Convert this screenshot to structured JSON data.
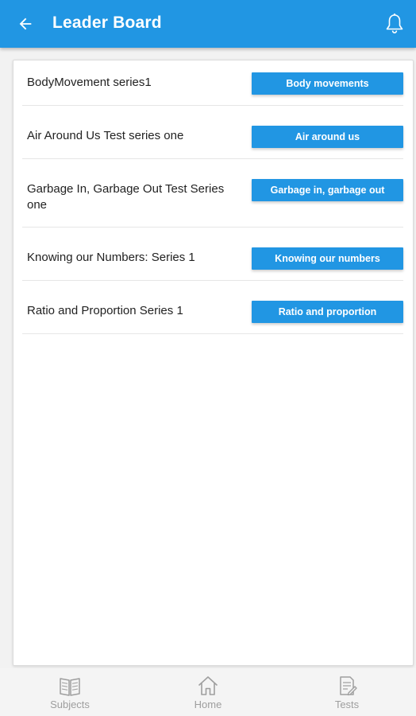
{
  "app_bar": {
    "title": "Leader Board",
    "back_icon": "arrow-left-icon",
    "notification_icon": "bell-icon",
    "color": "#2196e3"
  },
  "tests": [
    {
      "label": "BodyMovement series1",
      "button": "Body movements"
    },
    {
      "label": "Air Around Us Test series one",
      "button": "Air around us"
    },
    {
      "label": "Garbage In, Garbage Out Test Series one",
      "button": "Garbage in, garbage out"
    },
    {
      "label": "Knowing our Numbers: Series 1",
      "button": "Knowing our numbers"
    },
    {
      "label": "Ratio and Proportion Series 1",
      "button": "Ratio and proportion"
    }
  ],
  "bottom_nav": {
    "items": [
      {
        "label": "Subjects",
        "icon": "book-icon"
      },
      {
        "label": "Home",
        "icon": "home-icon"
      },
      {
        "label": "Tests",
        "icon": "test-sheet-icon"
      }
    ],
    "inactive_color": "#9e9e9e"
  }
}
